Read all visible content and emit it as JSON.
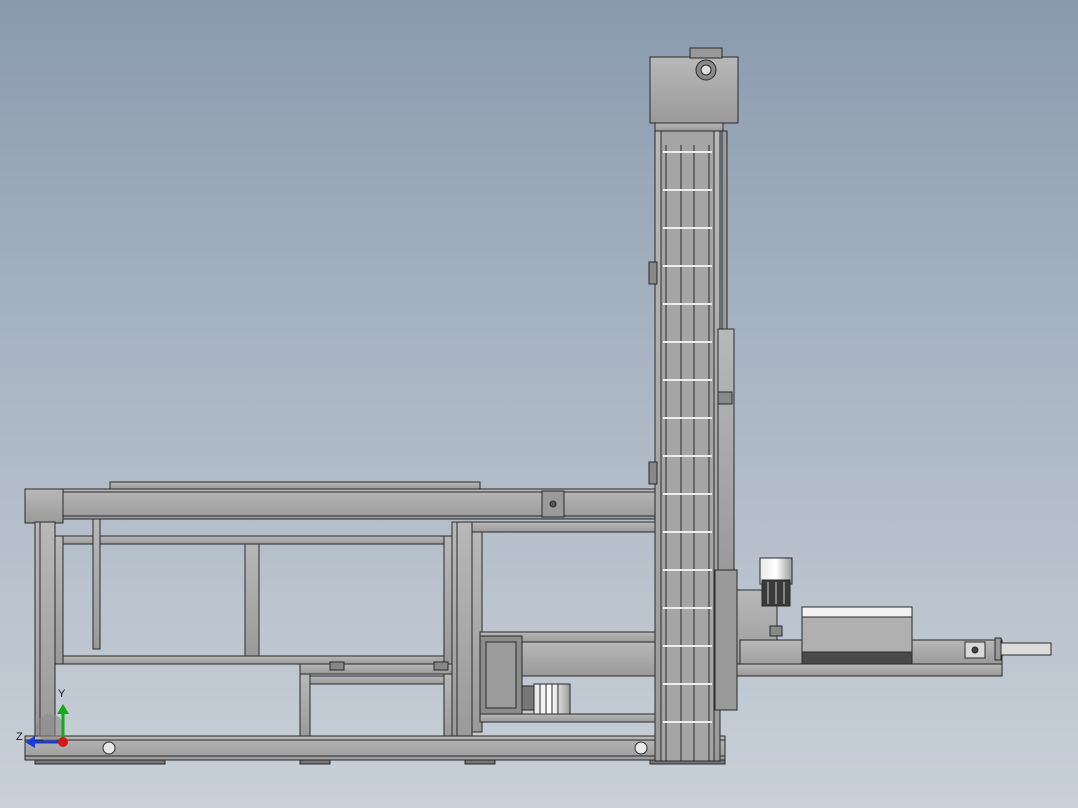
{
  "viewport": {
    "background_top": "#8a9aae",
    "background_bottom": "#c9d0d8",
    "part_fill": "#a9a9a9",
    "part_stroke": "#2a2a2a"
  },
  "triad": {
    "y_label": "Y",
    "z_label": "Z",
    "y_color": "#1aa61a",
    "z_color": "#1a3ad0",
    "x_color": "#d01a1a"
  }
}
